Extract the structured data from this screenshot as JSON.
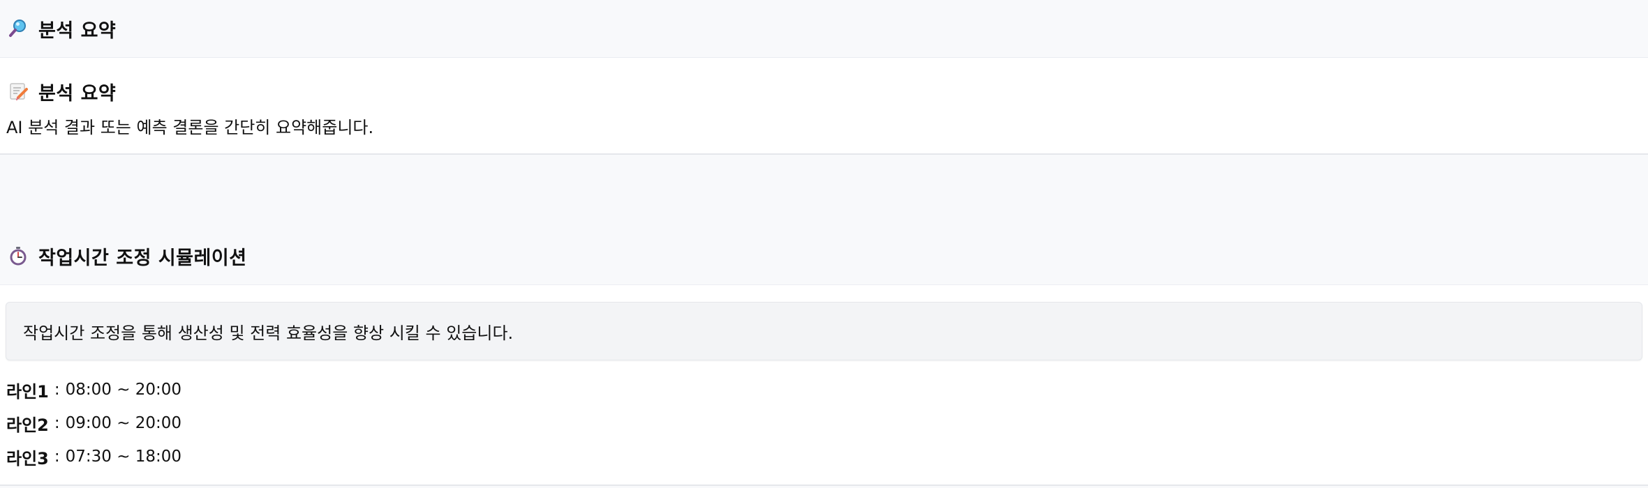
{
  "analysis_header": {
    "icon": "magnifier-icon",
    "title": "분석 요약"
  },
  "summary_card": {
    "icon": "memo-icon",
    "title": "분석 요약",
    "description": "AI 분석 결과 또는 예측 결론을 간단히 요약해줍니다."
  },
  "worktime_header": {
    "icon": "stopwatch-icon",
    "title": "작업시간 조정 시뮬레이션"
  },
  "worktime_card": {
    "info": "작업시간 조정을 통해 생산성 및 전력 효율성을 향상 시킬 수 있습니다.",
    "separator": ":",
    "lines": [
      {
        "name": "라인1",
        "time": "08:00 ~ 20:00"
      },
      {
        "name": "라인2",
        "time": "09:00 ~ 20:00"
      },
      {
        "name": "라인3",
        "time": "07:30 ~ 18:00"
      }
    ]
  }
}
